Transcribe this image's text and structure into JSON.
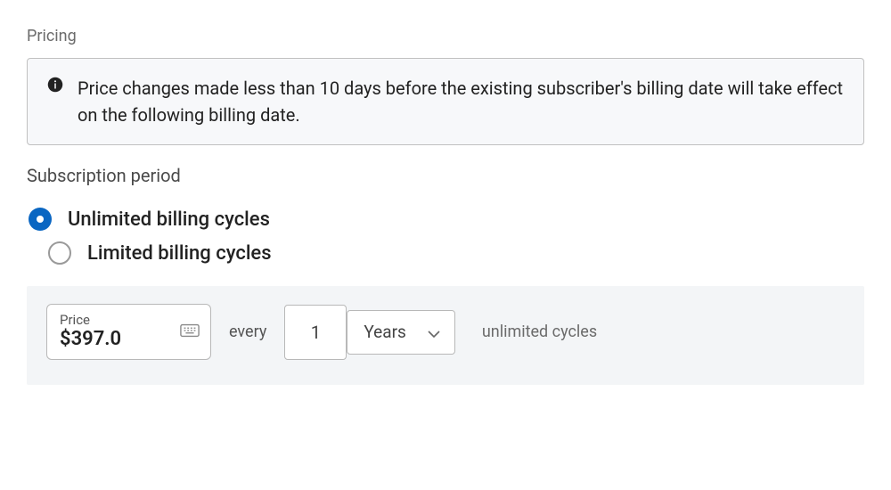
{
  "pricing": {
    "heading": "Pricing",
    "info_message": "Price changes made less than 10 days before the existing subscriber's billing date will take effect on the following billing date."
  },
  "subscription": {
    "heading": "Subscription period",
    "options": {
      "unlimited": "Unlimited billing cycles",
      "limited": "Limited billing cycles"
    },
    "selected": "unlimited"
  },
  "price_config": {
    "price_label": "Price",
    "price_value": "$397.0",
    "every_label": "every",
    "interval_count": "1",
    "interval_unit": "Years",
    "cycles_text": "unlimited cycles"
  }
}
